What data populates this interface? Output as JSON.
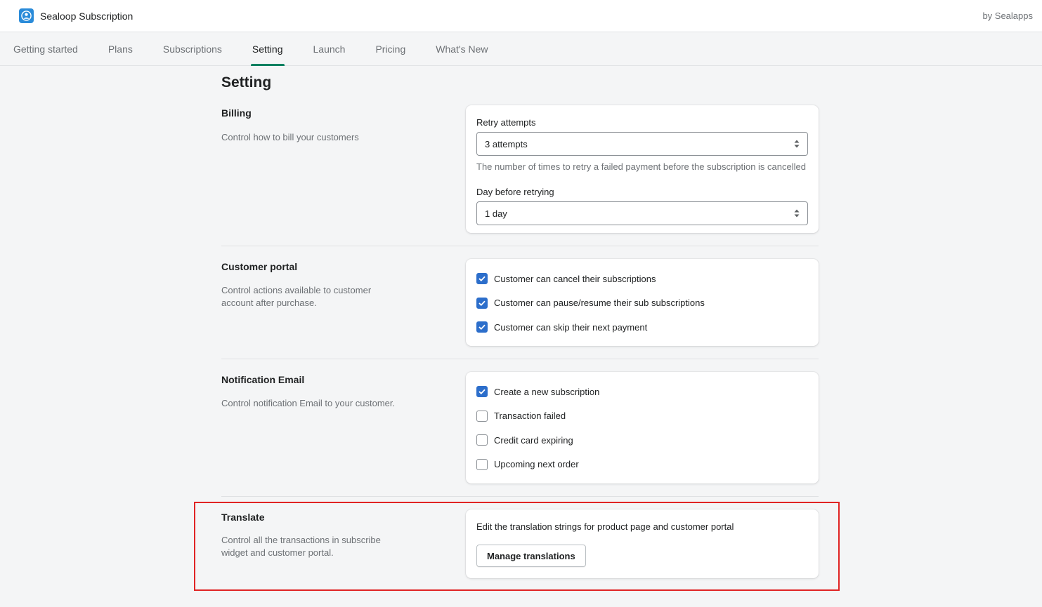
{
  "app": {
    "title": "Sealoop Subscription",
    "vendor": "by Sealapps",
    "logo_icon": "sealoop-logo-icon",
    "brand_color": "#2a8bd9"
  },
  "tabs": [
    {
      "label": "Getting started",
      "active": false
    },
    {
      "label": "Plans",
      "active": false
    },
    {
      "label": "Subscriptions",
      "active": false
    },
    {
      "label": "Setting",
      "active": true
    },
    {
      "label": "Launch",
      "active": false
    },
    {
      "label": "Pricing",
      "active": false
    },
    {
      "label": "What's New",
      "active": false
    }
  ],
  "page": {
    "title": "Setting"
  },
  "billing": {
    "heading": "Billing",
    "description": "Control how to bill your customers",
    "retry_label": "Retry attempts",
    "retry_value": "3 attempts",
    "retry_help": "The number of times to retry a failed payment before the subscription is cancelled",
    "day_label": "Day before retrying",
    "day_value": "1 day"
  },
  "customer_portal": {
    "heading": "Customer portal",
    "description": "Control actions available to customer account after purchase.",
    "options": [
      {
        "label": "Customer can cancel their subscriptions",
        "checked": true
      },
      {
        "label": "Customer can pause/resume their sub subscriptions",
        "checked": true
      },
      {
        "label": "Customer can skip their next payment",
        "checked": true
      }
    ]
  },
  "notification_email": {
    "heading": "Notification Email",
    "description": "Control notification Email to your customer.",
    "options": [
      {
        "label": "Create a new subscription",
        "checked": true
      },
      {
        "label": "Transaction failed",
        "checked": false
      },
      {
        "label": "Credit card expiring",
        "checked": false
      },
      {
        "label": "Upcoming next order",
        "checked": false
      }
    ]
  },
  "translate": {
    "heading": "Translate",
    "description": "Control all the transactions in subscribe widget and customer portal.",
    "card_text": "Edit the translation strings for product page and customer portal",
    "button_label": "Manage translations"
  },
  "colors": {
    "accent_tab": "#008060",
    "checkbox_checked": "#2c6ecb",
    "highlight": "#e02424"
  }
}
